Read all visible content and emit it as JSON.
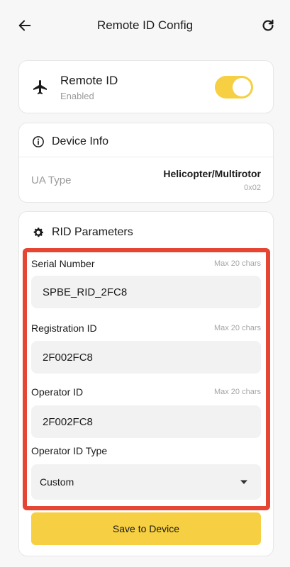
{
  "header": {
    "title": "Remote ID Config"
  },
  "remote_id": {
    "title": "Remote ID",
    "status": "Enabled",
    "enabled": true
  },
  "device_info": {
    "title": "Device Info",
    "ua_type_label": "UA Type",
    "ua_type_value": "Helicopter/Multirotor",
    "ua_type_code": "0x02"
  },
  "rid_params": {
    "title": "RID Parameters",
    "serial_number": {
      "label": "Serial Number",
      "hint": "Max 20 chars",
      "value": "SPBE_RID_2FC8"
    },
    "registration_id": {
      "label": "Registration ID",
      "hint": "Max 20 chars",
      "value": "2F002FC8"
    },
    "operator_id": {
      "label": "Operator ID",
      "hint": "Max 20 chars",
      "value": "2F002FC8"
    },
    "operator_id_type": {
      "label": "Operator ID Type",
      "value": "Custom"
    },
    "save_label": "Save to Device"
  },
  "colors": {
    "accent": "#f6cf42",
    "highlight": "#e54532"
  }
}
